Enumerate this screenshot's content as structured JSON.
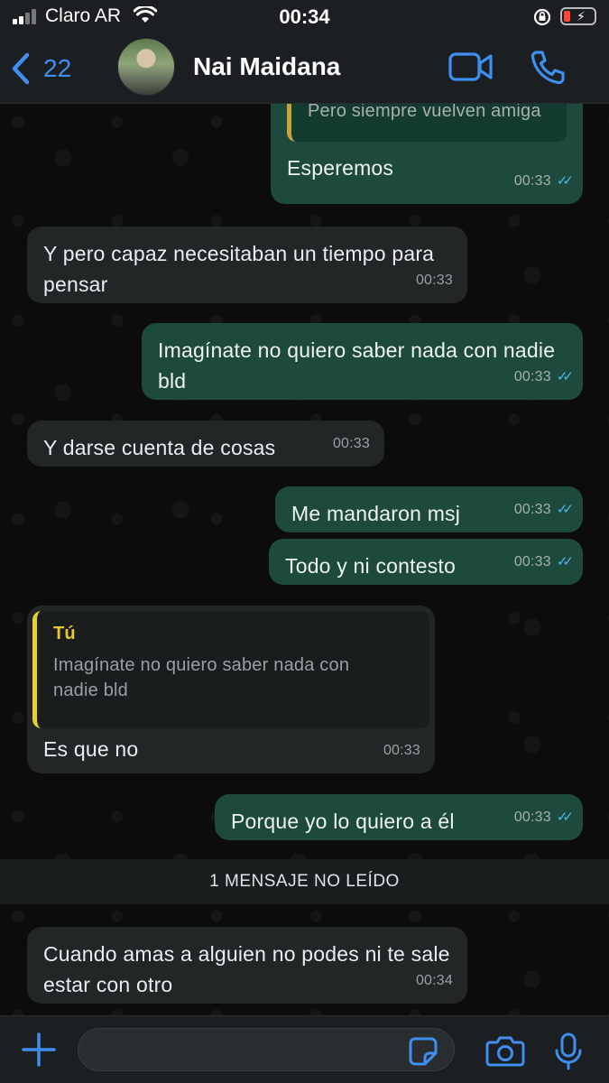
{
  "status_bar": {
    "carrier": "Claro AR",
    "time": "00:34"
  },
  "header": {
    "back_count": "22",
    "contact_name": "Nai Maidana"
  },
  "messages": [
    {
      "dir": "out",
      "quote_text": "Pero siempre vuelven amiga",
      "text": "Esperemos",
      "time": "00:33"
    },
    {
      "dir": "in",
      "text": "Y pero capaz necesitaban un tiempo para pensar",
      "time": "00:33"
    },
    {
      "dir": "out",
      "text": "Imagínate no quiero saber nada con nadie bld",
      "time": "00:33"
    },
    {
      "dir": "in",
      "text": "Y darse cuenta de cosas",
      "time": "00:33"
    },
    {
      "dir": "out",
      "text": "Me mandaron msj",
      "time": "00:33"
    },
    {
      "dir": "out",
      "text": "Todo y ni contesto",
      "time": "00:33"
    },
    {
      "dir": "in",
      "quote_author": "Tú",
      "quote_text": "Imagínate no quiero saber nada con nadie bld",
      "text": "Es que no",
      "time": "00:33"
    },
    {
      "dir": "out",
      "text": "Porque yo lo quiero a él",
      "time": "00:33"
    },
    {
      "dir": "in",
      "text": "Cuando amas a alguien no podes ni te sale estar con otro",
      "time": "00:34"
    }
  ],
  "unread_banner": "1 MENSAJE NO LEÍDO",
  "composer": {
    "placeholder": ""
  },
  "colors": {
    "accent": "#3f8ff0",
    "outgoing_bubble": "#1d4a3d",
    "incoming_bubble": "#232626",
    "read_ticks": "#4fb6ec",
    "quote_bar": "#e7d12e"
  },
  "icons": [
    "signal-icon",
    "wifi-icon",
    "orientation-lock-icon",
    "battery-icon",
    "back-chevron-icon",
    "video-call-icon",
    "phone-call-icon",
    "plus-icon",
    "sticker-icon",
    "camera-icon",
    "mic-icon",
    "read-ticks-icon"
  ]
}
